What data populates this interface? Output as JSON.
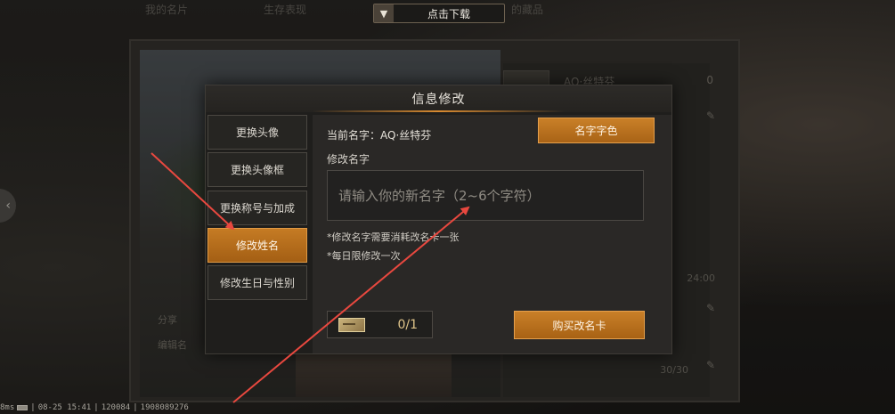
{
  "top_tabs": {
    "tab1": "我的名片",
    "tab2": "生存表现",
    "tab3": "的藏品"
  },
  "download": {
    "label": "点击下载",
    "icon": "download-arrow-icon"
  },
  "background": {
    "player_name": "AQ·丝特芬",
    "badge": "0",
    "time": "24:00",
    "count": "30/30",
    "share": "分享",
    "edit": "编辑名",
    "left_button_glyph": "‹"
  },
  "status_bar": {
    "latency": "8ms",
    "datetime": "08-25 15:41",
    "id1": "120084",
    "id2": "1908089276"
  },
  "modal": {
    "title": "信息修改",
    "menu": [
      {
        "label": "更换头像",
        "active": false
      },
      {
        "label": "更换头像框",
        "active": false
      },
      {
        "label": "更换称号与加成",
        "active": false
      },
      {
        "label": "修改姓名",
        "active": true
      },
      {
        "label": "修改生日与性别",
        "active": false
      }
    ],
    "current_name_label": "当前名字：AQ·丝特芬",
    "name_color_button": "名字字色",
    "section_label": "修改名字",
    "input_placeholder": "请输入你的新名字（2~6个字符）",
    "input_value": "",
    "note1": "*修改名字需要消耗改名卡一张",
    "note2": "*每日限修改一次",
    "card_count": "0/1",
    "buy_button": "购买改名卡"
  },
  "colors": {
    "accent": "#c57b24",
    "arrow": "#e8483f"
  }
}
